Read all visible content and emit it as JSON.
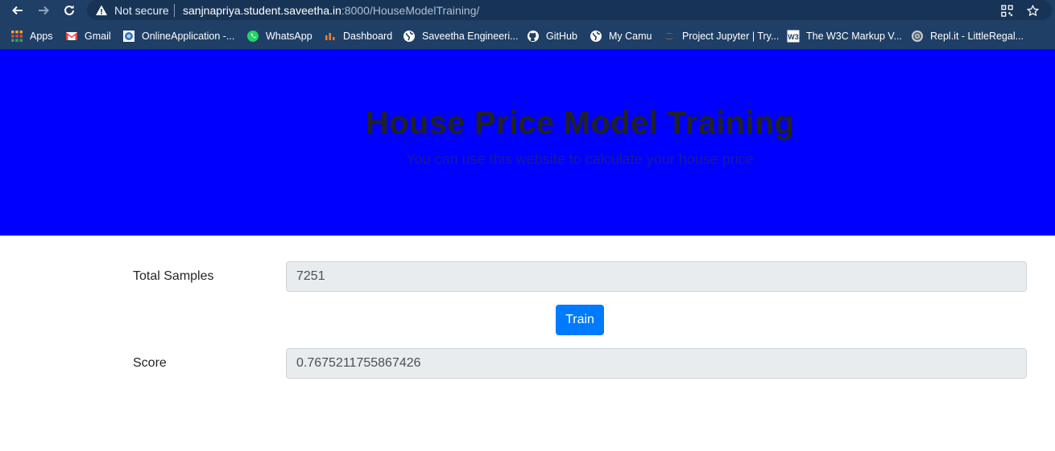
{
  "browser": {
    "security_label": "Not secure",
    "url_host": "sanjnapriya.student.saveetha.in",
    "url_rest": ":8000/HouseModelTraining/",
    "chrome_color": "#1f3f66"
  },
  "bookmarks": [
    {
      "label": "Apps",
      "icon": "apps-grid-icon"
    },
    {
      "label": "Gmail",
      "icon": "gmail-icon"
    },
    {
      "label": "OnlineApplication -...",
      "icon": "online-application-icon"
    },
    {
      "label": "WhatsApp",
      "icon": "whatsapp-icon"
    },
    {
      "label": "Dashboard",
      "icon": "dashboard-icon"
    },
    {
      "label": "Saveetha Engineeri...",
      "icon": "globe-icon"
    },
    {
      "label": "GitHub",
      "icon": "github-icon"
    },
    {
      "label": "My Camu",
      "icon": "globe-icon"
    },
    {
      "label": "Project Jupyter | Try...",
      "icon": "jupyter-icon"
    },
    {
      "label": "The W3C Markup V...",
      "icon": "w3c-icon"
    },
    {
      "label": "Repl.it - LittleRegal...",
      "icon": "replit-icon"
    }
  ],
  "hero": {
    "title": "House Price Model Training",
    "subtitle": "You can use this website to calculate your house price",
    "background_color": "#0000ff"
  },
  "form": {
    "samples_label": "Total Samples",
    "samples_value": "7251",
    "train_label": "Train",
    "score_label": "Score",
    "score_value": "0.7675211755867426",
    "button_color": "#007bff"
  }
}
